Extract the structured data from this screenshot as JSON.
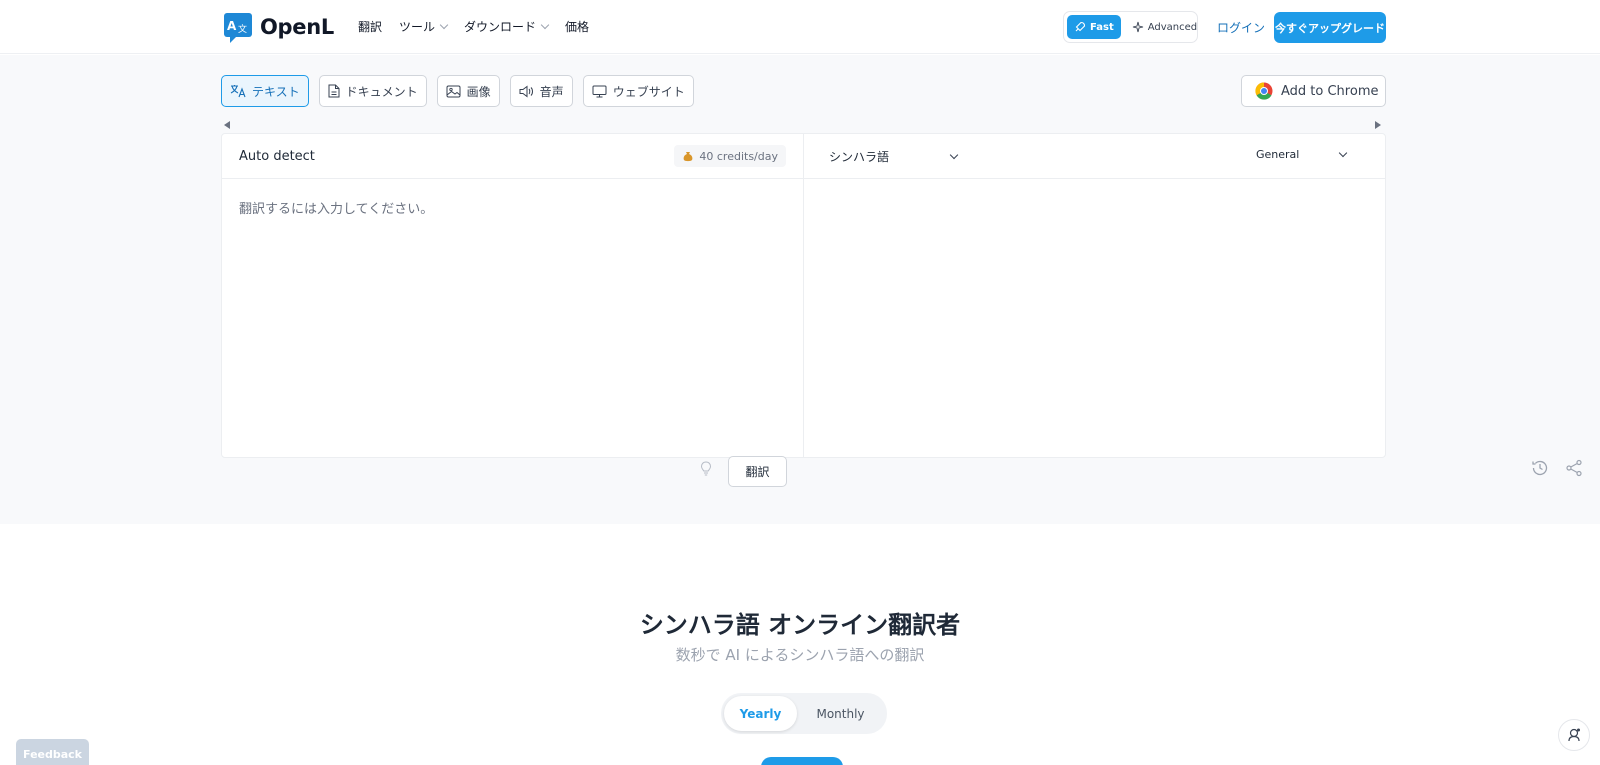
{
  "header": {
    "logo_text": "OpenL",
    "nav": [
      {
        "label": "翻訳",
        "has_menu": false
      },
      {
        "label": "ツール",
        "has_menu": true
      },
      {
        "label": "ダウンロード",
        "has_menu": true
      },
      {
        "label": "価格",
        "has_menu": false
      }
    ],
    "mode_fast": "Fast",
    "mode_advanced": "Advanced",
    "login": "ログイン",
    "upgrade": "今すぐアップグレード"
  },
  "tabs": [
    {
      "label": "テキスト",
      "icon": "translate-icon",
      "active": true
    },
    {
      "label": "ドキュメント",
      "icon": "document-icon",
      "active": false
    },
    {
      "label": "画像",
      "icon": "image-icon",
      "active": false
    },
    {
      "label": "音声",
      "icon": "speaker-icon",
      "active": false
    },
    {
      "label": "ウェブサイト",
      "icon": "monitor-icon",
      "active": false
    }
  ],
  "add_to_chrome": "Add to Chrome",
  "translator": {
    "source_language": "Auto detect",
    "credits": "40 credits/day",
    "placeholder": "翻訳するには入力してください。",
    "translate_button": "翻訳",
    "target_language": "シンハラ語",
    "target_mode": "General"
  },
  "hero": {
    "title": "シンハラ語 オンライン翻訳者",
    "subtitle": "数秒で AI によるシンハラ語への翻訳"
  },
  "billing": {
    "yearly": "Yearly",
    "monthly": "Monthly"
  },
  "feedback": "Feedback",
  "colors": {
    "accent": "#1e9be8",
    "link": "#1570b8",
    "stage_bg": "#f8f9fb"
  }
}
